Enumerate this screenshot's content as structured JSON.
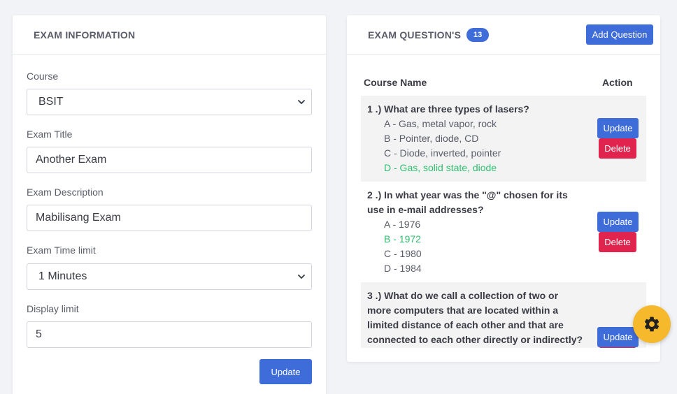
{
  "exam_info": {
    "title": "EXAM INFORMATION",
    "course_label": "Course",
    "course_value": "BSIT",
    "exam_title_label": "Exam Title",
    "exam_title_value": "Another Exam",
    "exam_description_label": "Exam Description",
    "exam_description_value": "Mabilisang Exam",
    "time_limit_label": "Exam Time limit",
    "time_limit_value": "1 Minutes",
    "display_limit_label": "Display limit",
    "display_limit_value": "5",
    "update_label": "Update"
  },
  "questions_panel": {
    "title": "EXAM QUESTION'S",
    "count": "13",
    "add_label": "Add Question",
    "col_course": "Course Name",
    "col_action": "Action",
    "update_label": "Update",
    "delete_label": "Delete",
    "questions": [
      {
        "text": "1 .) What are three types of lasers?",
        "options": [
          "A - Gas, metal vapor, rock",
          "B - Pointer, diode, CD",
          "C - Diode, inverted, pointer",
          "D - Gas, solid state, diode"
        ],
        "correct": "D"
      },
      {
        "text_line1": "2 .) In what year was the \"@\" chosen for its",
        "text_line2": "use in e-mail addresses?",
        "options": [
          "A - 1976",
          "B - 1972",
          "C - 1980",
          "D - 1984"
        ],
        "correct": "B"
      },
      {
        "text_line1": "3 .) What do we call a collection of two or",
        "text_line2": "more computers that are located within a",
        "text_line3": "limited distance of each other and that are",
        "text_line4": "connected to each other directly or indirectly?"
      }
    ]
  },
  "colors": {
    "primary": "#3e6cd8",
    "danger": "#e0244e",
    "success": "#2ebf6e",
    "fab": "#f6b92b"
  },
  "icons": {
    "fab": "gear-icon",
    "select": "chevron-down-icon"
  }
}
